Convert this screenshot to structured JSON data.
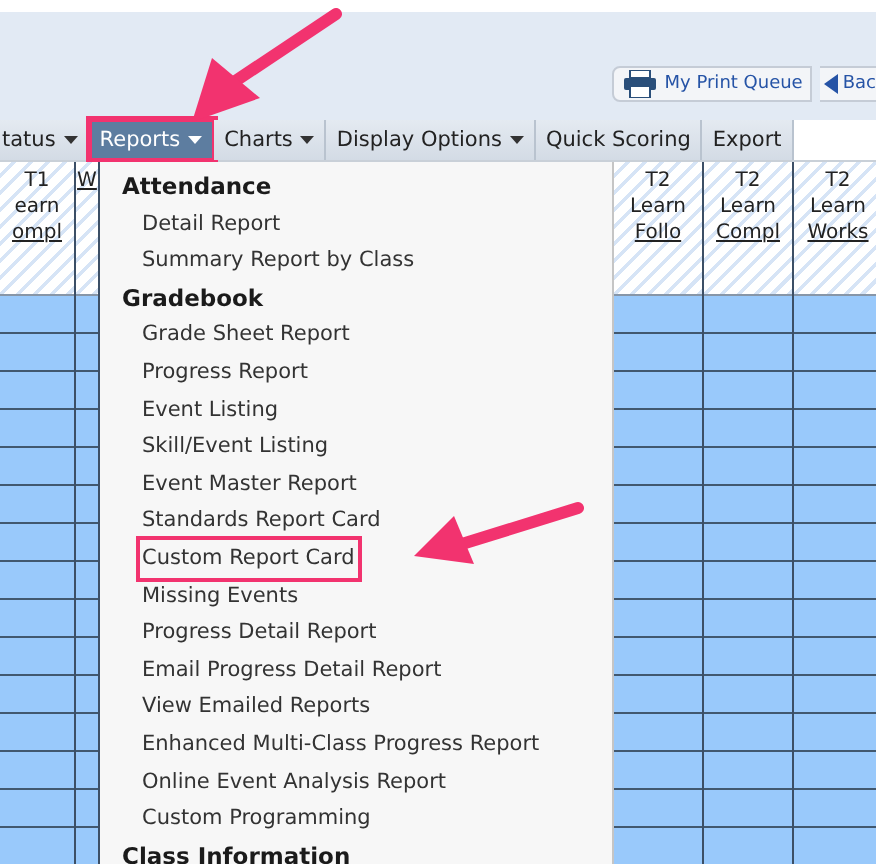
{
  "toolbar": {
    "print_queue": "My Print Queue",
    "back": "Bac"
  },
  "menu_bar": [
    {
      "label": "tatus",
      "dropdown": true,
      "selected": false,
      "annotated": false
    },
    {
      "label": "Reports",
      "dropdown": true,
      "selected": true,
      "annotated": true
    },
    {
      "label": "Charts",
      "dropdown": true,
      "selected": false,
      "annotated": false
    },
    {
      "label": "Display Options",
      "dropdown": true,
      "selected": false,
      "annotated": false
    },
    {
      "label": "Quick Scoring",
      "dropdown": false,
      "selected": false,
      "annotated": false
    },
    {
      "label": "Export",
      "dropdown": false,
      "selected": false,
      "annotated": false
    }
  ],
  "left_columns": [
    {
      "title": "T1",
      "line2": "earn",
      "link": "ompl"
    },
    {
      "link": "W"
    }
  ],
  "right_columns": [
    {
      "title": "T2",
      "line2": "Learn",
      "link": "Follo"
    },
    {
      "title": "T2",
      "line2": "Learn",
      "link": "Compl"
    },
    {
      "title": "T2",
      "line2": "Learn",
      "link": "Works"
    }
  ],
  "reports_menu": [
    {
      "heading": "Attendance",
      "items": [
        {
          "label": "Detail Report",
          "annotated": false
        },
        {
          "label": "Summary Report by Class",
          "annotated": false
        }
      ]
    },
    {
      "heading": "Gradebook",
      "items": [
        {
          "label": "Grade Sheet Report",
          "annotated": false
        },
        {
          "label": "Progress Report",
          "annotated": false
        },
        {
          "label": "Event Listing",
          "annotated": false
        },
        {
          "label": "Skill/Event Listing",
          "annotated": false
        },
        {
          "label": "Event Master Report",
          "annotated": false
        },
        {
          "label": "Standards Report Card",
          "annotated": false
        },
        {
          "label": "Custom Report Card",
          "annotated": true
        },
        {
          "label": "Missing Events",
          "annotated": false
        },
        {
          "label": "Progress Detail Report",
          "annotated": false
        },
        {
          "label": "Email Progress Detail Report",
          "annotated": false
        },
        {
          "label": "View Emailed Reports",
          "annotated": false
        },
        {
          "label": "Enhanced Multi-Class Progress Report",
          "annotated": false
        },
        {
          "label": "Online Event Analysis Report",
          "annotated": false
        },
        {
          "label": "Custom Programming",
          "annotated": false
        }
      ]
    },
    {
      "heading": "Class Information"
    }
  ]
}
